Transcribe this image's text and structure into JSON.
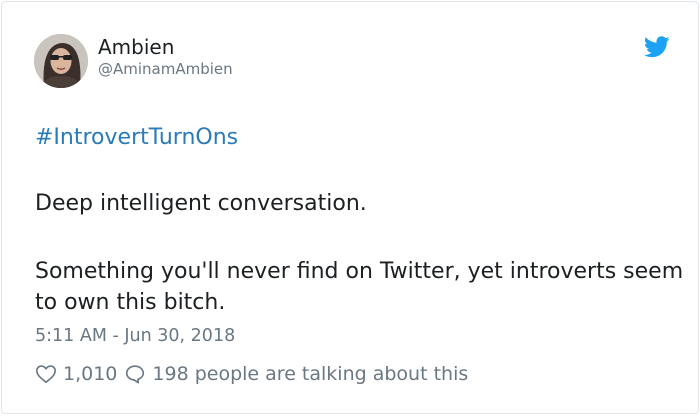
{
  "author": {
    "display_name": "Ambien",
    "handle": "@AminamAmbien"
  },
  "tweet": {
    "hashtag": "#IntrovertTurnOns",
    "line1": "Deep intelligent conversation.",
    "line2": "Something you'll never find on Twitter, yet introverts seem to own this bitch.",
    "timestamp": "5:11 AM - Jun 30, 2018"
  },
  "engagement": {
    "likes": "1,010",
    "talking": "198 people are talking about this"
  },
  "icons": {
    "brand": "twitter-bird-icon",
    "like": "heart-icon",
    "reply": "speech-bubble-icon"
  },
  "colors": {
    "link": "#2b7bb9",
    "brand": "#1da1f2",
    "muted": "#697882",
    "text": "#1c2022"
  }
}
